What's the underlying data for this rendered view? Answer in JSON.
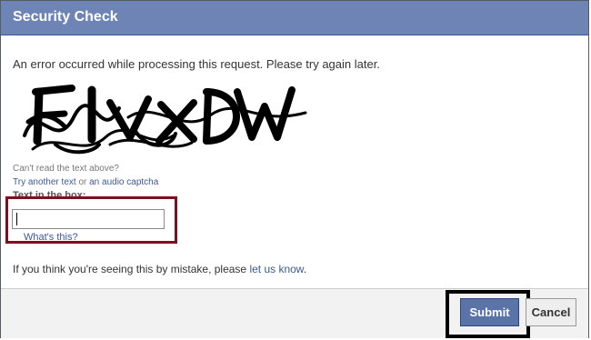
{
  "dialog": {
    "title": "Security Check",
    "error_message": "An error occurred while processing this request. Please try again later."
  },
  "captcha": {
    "image_text": "FIVXDW",
    "cant_read": "Can't read the text above?",
    "try_another": "Try another text",
    "or": " or ",
    "audio_captcha": "an audio captcha",
    "input_label": "Text in the box:",
    "input_value": "",
    "whats_this": "What's this?"
  },
  "mistake": {
    "text": "If you think you're seeing this by mistake, please ",
    "link": "let us know",
    "suffix": "."
  },
  "buttons": {
    "submit": "Submit",
    "cancel": "Cancel"
  },
  "colors": {
    "title_bar": "#6d84b4",
    "link": "#3b5998",
    "submit_bg": "#5b74a8",
    "highlight_red": "#7a1020",
    "highlight_black": "#000000"
  }
}
